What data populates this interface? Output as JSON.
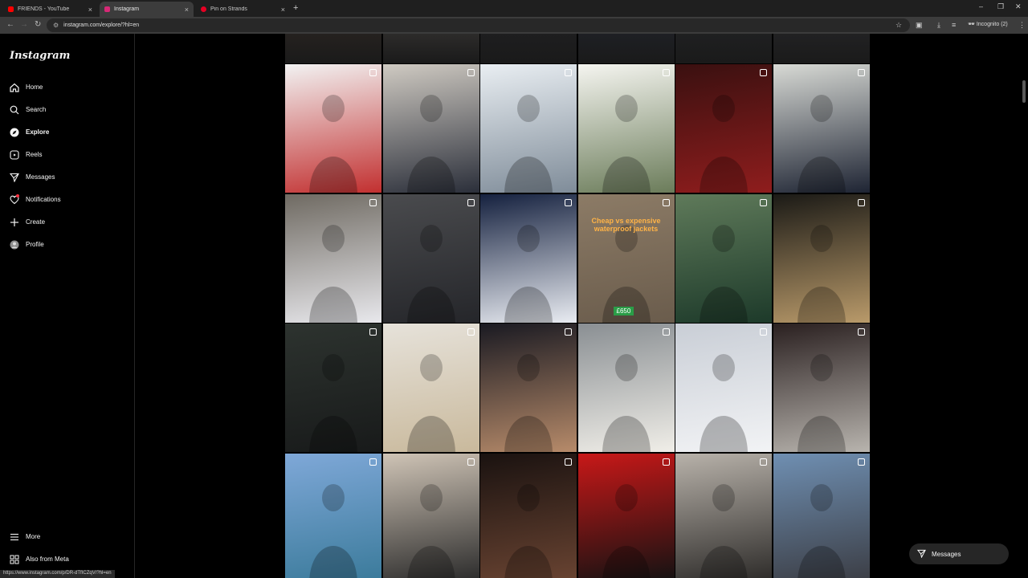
{
  "browser": {
    "tabs": [
      {
        "title": "FRIENDS - YouTube",
        "favicon_color": "#ff0000"
      },
      {
        "title": "Instagram",
        "favicon_color": "#d62976"
      },
      {
        "title": "Pin on Strands",
        "favicon_color": "#e60023"
      }
    ],
    "url": "instagram.com/explore/?hl=en",
    "incognito_label": "Incognito (2)",
    "status_url": "https://www.instagram.com/p/DR-dTfICZqV/?hl=en"
  },
  "sidebar": {
    "logo": "Instagram",
    "items": [
      {
        "label": "Home",
        "icon": "home-icon"
      },
      {
        "label": "Search",
        "icon": "search-icon"
      },
      {
        "label": "Explore",
        "icon": "explore-icon"
      },
      {
        "label": "Reels",
        "icon": "reels-icon"
      },
      {
        "label": "Messages",
        "icon": "messages-icon"
      },
      {
        "label": "Notifications",
        "icon": "heart-icon"
      },
      {
        "label": "Create",
        "icon": "plus-icon"
      },
      {
        "label": "Profile",
        "icon": "profile-icon"
      }
    ],
    "bottom": [
      {
        "label": "More",
        "icon": "menu-icon"
      },
      {
        "label": "Also from Meta",
        "icon": "meta-icon"
      }
    ]
  },
  "grid": {
    "posts": [
      {
        "colors": [
          "#f2f2f2",
          "#c23030"
        ]
      },
      {
        "colors": [
          "#cfcac2",
          "#2b2f3a"
        ]
      },
      {
        "colors": [
          "#e9eef2",
          "#7f8c99"
        ]
      },
      {
        "colors": [
          "#f5f5f0",
          "#6b7c5a"
        ]
      },
      {
        "colors": [
          "#3a1010",
          "#8f1d1d"
        ]
      },
      {
        "colors": [
          "#d8dad5",
          "#1e2433"
        ]
      },
      {
        "colors": [
          "#6f6a62",
          "#e8e8ec"
        ]
      },
      {
        "colors": [
          "#4a4b4e",
          "#25262a"
        ]
      },
      {
        "colors": [
          "#15213f",
          "#e9ecf2"
        ]
      },
      {
        "colors": [
          "#8c7b66",
          "#6a5c4c"
        ],
        "caption": "Cheap vs expensive waterproof jackets",
        "price": "£650"
      },
      {
        "colors": [
          "#5f7a5a",
          "#1d3a2a"
        ]
      },
      {
        "colors": [
          "#1b1a16",
          "#b99a6a"
        ]
      },
      {
        "colors": [
          "#2d332f",
          "#181a1a"
        ]
      },
      {
        "colors": [
          "#e6e2da",
          "#c9b99c"
        ]
      },
      {
        "colors": [
          "#1a1a22",
          "#b78b6a"
        ]
      },
      {
        "colors": [
          "#8a8f93",
          "#f0eee8"
        ]
      },
      {
        "colors": [
          "#c9ced6",
          "#f2f3f5"
        ]
      },
      {
        "colors": [
          "#2a2020",
          "#b8b4ae"
        ]
      },
      {
        "colors": [
          "#7fa8d8",
          "#3a7a9a"
        ]
      },
      {
        "colors": [
          "#cfc4b6",
          "#2a2a2a"
        ]
      },
      {
        "colors": [
          "#1a1210",
          "#6a4432"
        ]
      },
      {
        "colors": [
          "#c81818",
          "#121212"
        ]
      },
      {
        "colors": [
          "#b8b2aa",
          "#2c2a28"
        ]
      },
      {
        "colors": [
          "#6f8fb2",
          "#3b3d44"
        ]
      }
    ],
    "top_strip_colors": [
      "#4b3a30",
      "#6a6460",
      "#2a2a30",
      "#2b3245",
      "#303338",
      "#3a3a40"
    ]
  },
  "messages_pill": {
    "label": "Messages"
  }
}
